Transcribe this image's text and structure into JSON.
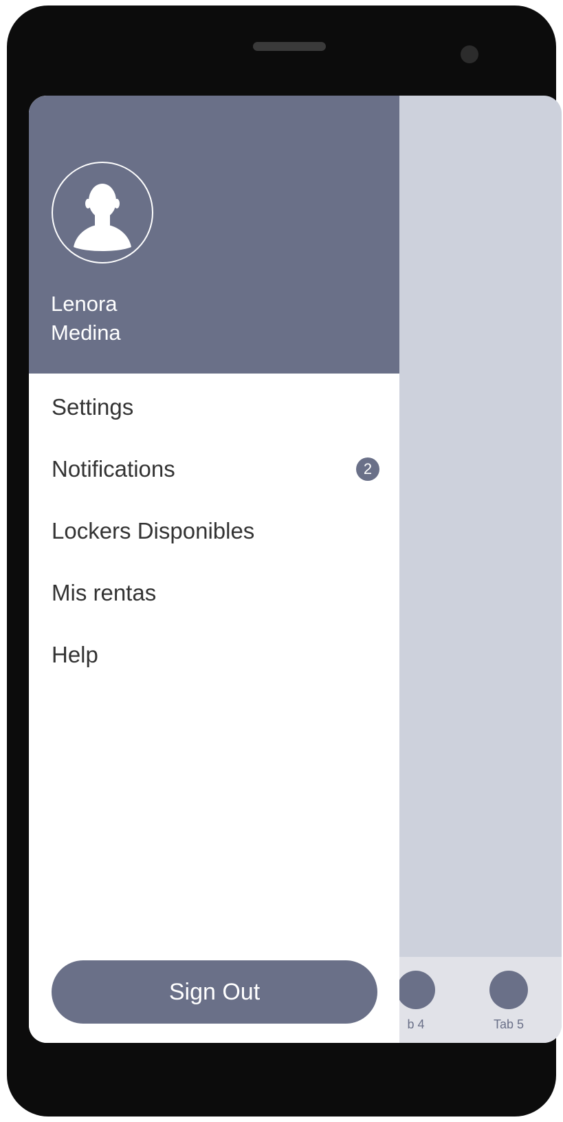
{
  "user": {
    "name": "Lenora Medina"
  },
  "menu": {
    "items": [
      {
        "label": "Settings"
      },
      {
        "label": "Notifications",
        "badge": "2"
      },
      {
        "label": "Lockers Disponibles"
      },
      {
        "label": "Mis rentas"
      },
      {
        "label": "Help"
      }
    ]
  },
  "actions": {
    "sign_out_label": "Sign Out"
  },
  "tabbar": {
    "tabs": [
      {
        "label": "b 4"
      },
      {
        "label": "Tab 5"
      }
    ]
  },
  "colors": {
    "accent": "#6a7088",
    "screen_background": "#cdd1dc",
    "tabbar_background": "#e1e2e8",
    "device_frame": "#0c0c0c"
  },
  "icons": {
    "avatar": "user-silhouette-icon"
  }
}
